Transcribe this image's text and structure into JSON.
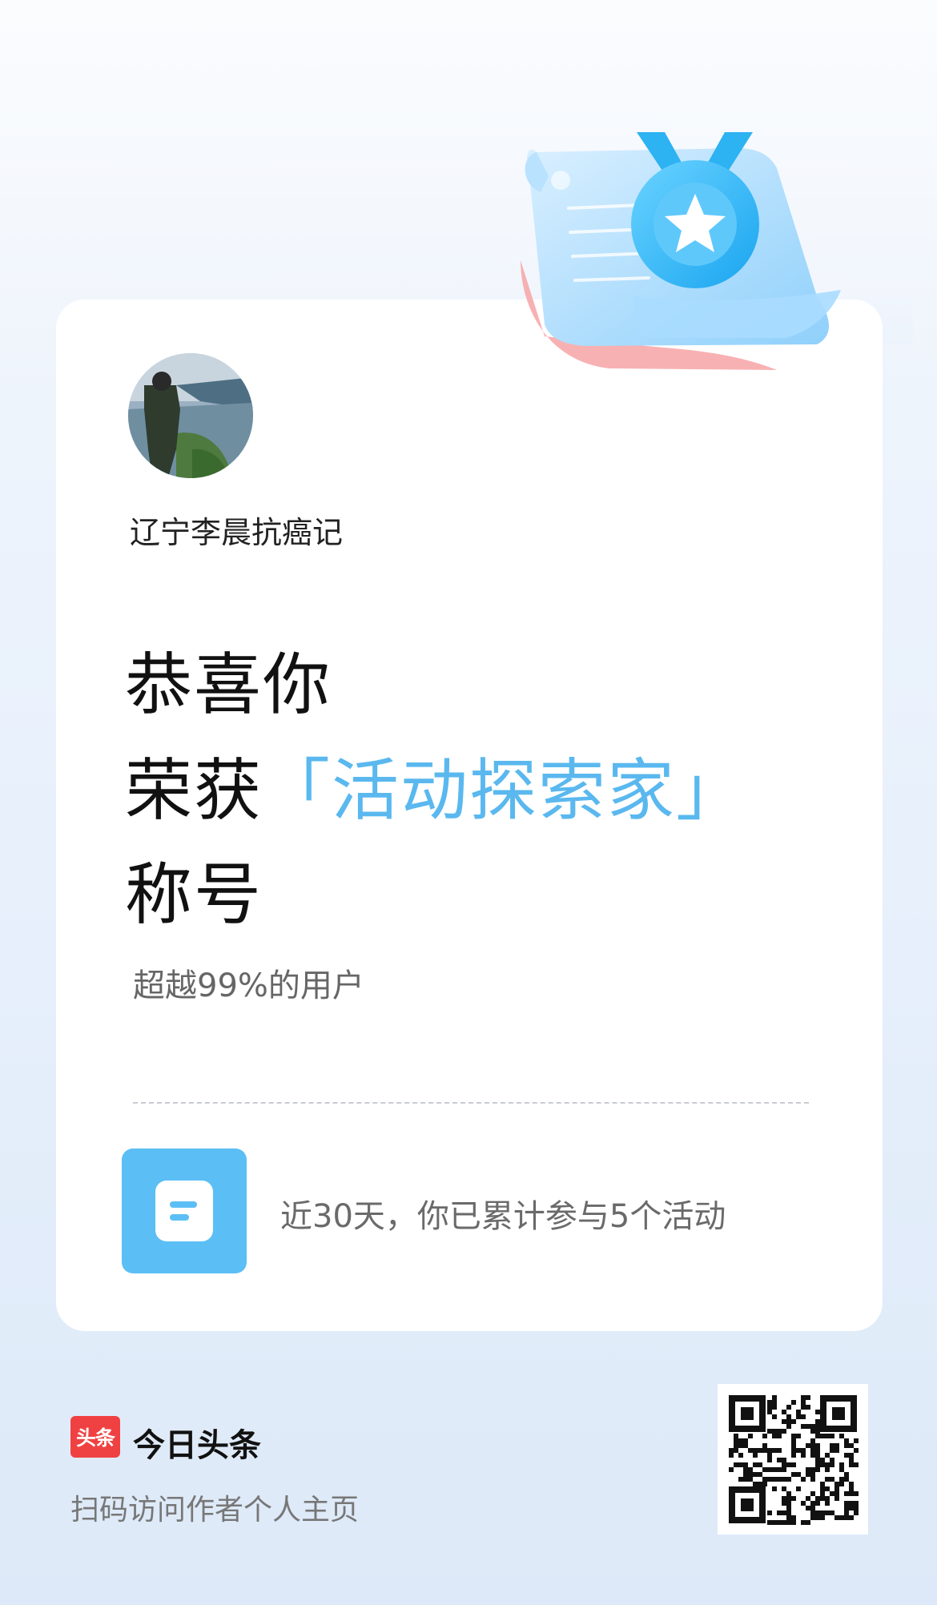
{
  "user": {
    "name": "辽宁李晨抗癌记"
  },
  "headline": {
    "line1": "恭喜你",
    "line2_prefix": "荣获",
    "title": "「活动探索家」",
    "line3": "称号"
  },
  "rank_text": "超越99%的用户",
  "activity": {
    "text": "近30天，你已累计参与5个活动"
  },
  "footer": {
    "logo_text": "头条",
    "app_name": "今日头条",
    "hint": "扫码访问作者个人主页"
  },
  "colors": {
    "accent": "#5ab8ef",
    "icon_bg": "#5bbff5",
    "logo_red": "#f04142"
  }
}
